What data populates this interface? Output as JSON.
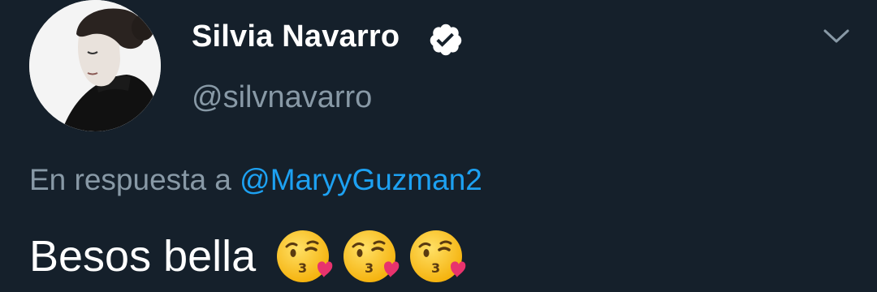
{
  "author": {
    "display_name": "Silvia Navarro",
    "handle": "@silvnavarro",
    "verified": true,
    "avatar_icon": "avatar-photo"
  },
  "icons": {
    "verified": "verified-badge-icon",
    "menu": "chevron-down-icon",
    "emoji": "face-blowing-a-kiss-emoji"
  },
  "reply": {
    "prefix": "En respuesta a",
    "mention": "@MaryyGuzman2"
  },
  "tweet": {
    "text": "Besos bella",
    "emoji_count": 3
  },
  "colors": {
    "background": "#15202b",
    "primary_text": "#ffffff",
    "secondary_text": "#8899a6",
    "link": "#1da1f2"
  }
}
